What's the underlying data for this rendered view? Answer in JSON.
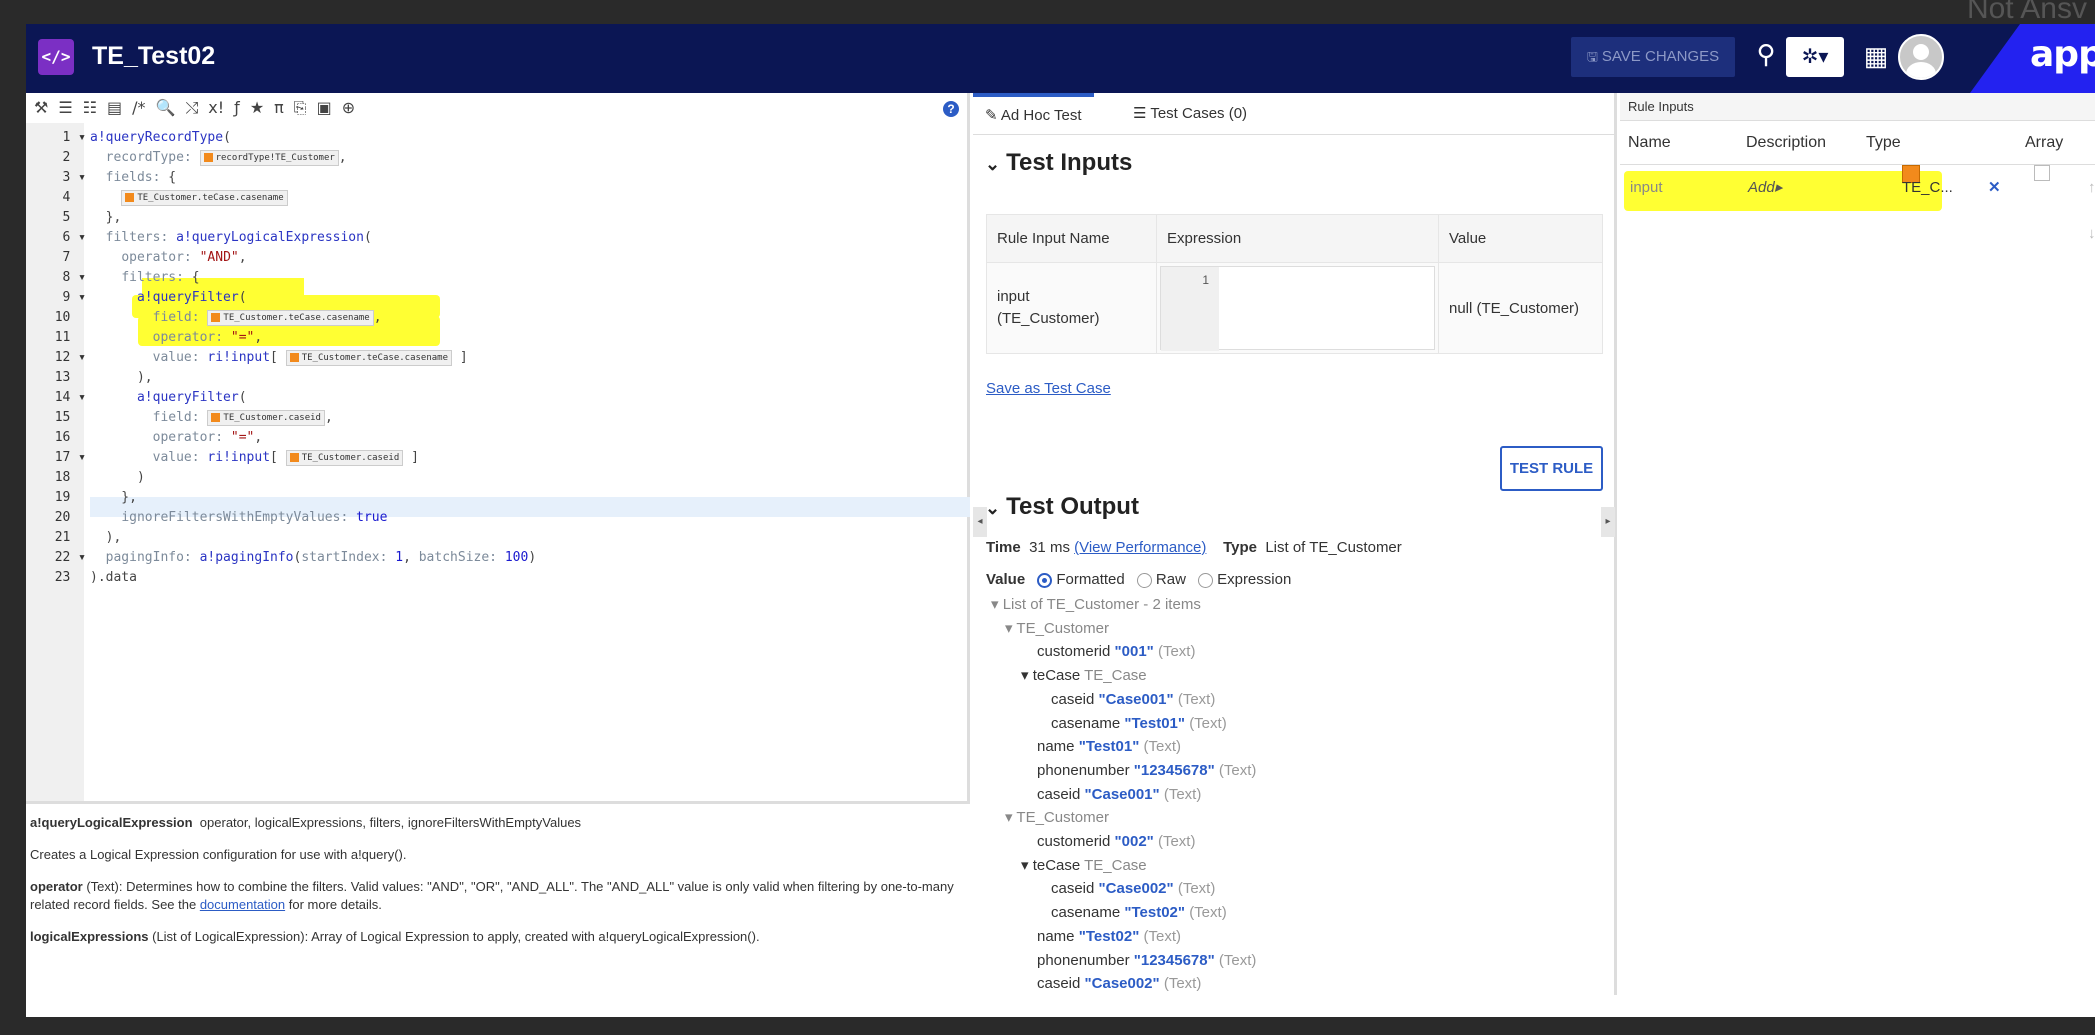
{
  "background": {
    "text": "Not Ansv"
  },
  "header": {
    "title": "TE_Test02",
    "logo_glyph": "</>",
    "save_label": "SAVE CHANGES",
    "brand": "appia",
    "icons": [
      "search-icon",
      "gear-icon",
      "apps-grid-icon",
      "user-avatar"
    ]
  },
  "editor": {
    "toolbar_icons": [
      "wrench-icon",
      "indent-icon",
      "outdent-icon",
      "list-icon",
      "comment-icon",
      "search-icon",
      "shuffle-icon",
      "xi-icon",
      "fx-icon",
      "star-icon",
      "pi-icon",
      "export-icon",
      "copy-icon",
      "web-icon"
    ],
    "toolbar_glyphs": [
      "⚒",
      "☰",
      "☷",
      "▤",
      "/*",
      "🔍",
      "⤭",
      "x!",
      "ƒ",
      "★",
      "π",
      "⎘",
      "▣",
      "⊕"
    ],
    "lines": [
      {
        "n": "1",
        "html": "<span class=\"kw\">a!queryRecordType</span>("
      },
      {
        "n": "2",
        "html": "  <span class=\"prop\">recordType:</span> <span class=\"tok\"><b></b>recordType!TE_Customer</span>,"
      },
      {
        "n": "3",
        "html": "  <span class=\"prop\">fields:</span> {"
      },
      {
        "n": "4",
        "html": "    <span class=\"tok\"><b></b>TE_Customer.teCase.casename</span>"
      },
      {
        "n": "5",
        "html": "  },"
      },
      {
        "n": "6",
        "html": "  <span class=\"prop\">filters:</span> <span class=\"kw\">a!queryLogicalExpression</span>("
      },
      {
        "n": "7",
        "html": "    <span class=\"prop\">operator:</span> <span class=\"str\">\"AND\"</span>,"
      },
      {
        "n": "8",
        "html": "    <span class=\"prop\">filters:</span> {"
      },
      {
        "n": "9",
        "html": "      <span class=\"kw\">a!queryFilter</span>("
      },
      {
        "n": "10",
        "html": "        <span class=\"prop\">field:</span> <span class=\"tok\"><b></b>TE_Customer.teCase.casename</span>,"
      },
      {
        "n": "11",
        "html": "        <span class=\"prop\">operator:</span> <span class=\"str\">\"=\"</span>,"
      },
      {
        "n": "12",
        "html": "        <span class=\"prop\">value:</span> <span class=\"kw\">ri!input</span>[ <span class=\"tok\"><b></b>TE_Customer.teCase.casename</span> ]"
      },
      {
        "n": "13",
        "html": "      ),"
      },
      {
        "n": "14",
        "html": "      <span class=\"kw\">a!queryFilter</span>("
      },
      {
        "n": "15",
        "html": "        <span class=\"prop\">field:</span> <span class=\"tok\"><b></b>TE_Customer.caseid</span>,"
      },
      {
        "n": "16",
        "html": "        <span class=\"prop\">operator:</span> <span class=\"str\">\"=\"</span>,"
      },
      {
        "n": "17",
        "html": "        <span class=\"prop\">value:</span> <span class=\"kw\">ri!input</span>[ <span class=\"tok\"><b></b>TE_Customer.caseid</span> ]"
      },
      {
        "n": "18",
        "html": "      )"
      },
      {
        "n": "19",
        "html": "    },"
      },
      {
        "n": "20",
        "html": "    <span class=\"prop\">ignoreFiltersWithEmptyValues:</span> <span class=\"num\">true</span>"
      },
      {
        "n": "21",
        "html": "  ),"
      },
      {
        "n": "22",
        "html": "  <span class=\"prop\">pagingInfo:</span> <span class=\"kw\">a!pagingInfo</span>(<span class=\"prop\">startIndex:</span> <span class=\"num\">1</span>, <span class=\"prop\">batchSize:</span> <span class=\"num\">100</span>)"
      },
      {
        "n": "23",
        "html": ").data"
      }
    ],
    "fold_lines": [
      "1",
      "3",
      "6",
      "8",
      "9",
      "12",
      "14",
      "17",
      "22"
    ],
    "doc": {
      "sig_name": "a!queryLogicalExpression",
      "sig_params": "operator, logicalExpressions, filters, ignoreFiltersWithEmptyValues",
      "desc": "Creates a Logical Expression configuration for use with a!query().",
      "op_name": "operator",
      "op_text": " (Text): Determines how to combine the filters. Valid values: \"AND\", \"OR\", \"AND_ALL\". The \"AND_ALL\" value is only valid when filtering by one-to-many related record fields. See the ",
      "op_link": "documentation",
      "op_tail": " for more details.",
      "le_name": "logicalExpressions",
      "le_text": " (List of LogicalExpression): Array of Logical Expression to apply, created with a!queryLogicalExpression()."
    }
  },
  "middle": {
    "tabs": [
      {
        "label": "Ad Hoc Test"
      },
      {
        "label": "Test Cases (0)"
      }
    ],
    "test_inputs_title": "Test Inputs",
    "columns": [
      "Rule Input Name",
      "Expression",
      "Value"
    ],
    "input_name": "input\n(TE_Customer)",
    "expr_line": "1",
    "input_value": "null (TE_Customer)",
    "save_test_case": "Save as Test Case",
    "test_rule": "TEST RULE",
    "test_output_title": "Test Output",
    "time_label": "Time",
    "time_value": "31 ms",
    "view_perf": "(View Performance)",
    "type_label": "Type",
    "type_value": "List of TE_Customer",
    "value_label": "Value",
    "radio_options": [
      "Formatted",
      "Raw",
      "Expression"
    ],
    "selected_radio": "Formatted",
    "tree_header": "List of TE_Customer - 2 items",
    "customers": [
      {
        "label": "TE_Customer",
        "customerid": "\"001\"",
        "caseid1": "\"Case001\"",
        "casename": "\"Test01\"",
        "name": "\"Test01\"",
        "phonenumber": "\"12345678\"",
        "caseid2": "\"Case001\""
      },
      {
        "label": "TE_Customer",
        "customerid": "\"002\"",
        "caseid1": "\"Case002\"",
        "casename": "\"Test02\"",
        "name": "\"Test02\"",
        "phonenumber": "\"12345678\"",
        "caseid2": "\"Case002\""
      }
    ],
    "field_names": {
      "customerid": "customerid",
      "tecase": "teCase",
      "tecase_type": "TE_Case",
      "caseid": "caseid",
      "casename": "casename",
      "name": "name",
      "phonenumber": "phonenumber"
    },
    "text_type": "(Text)"
  },
  "right": {
    "header": "Rule Inputs",
    "columns": [
      "Name",
      "Description",
      "Type",
      "Array"
    ],
    "row": {
      "name": "input",
      "description": "Add▸",
      "type": "TE_C...",
      "remove": "✕",
      "arrows": "↑ ↓"
    }
  },
  "colors": {
    "navy": "#0b1654",
    "accent": "#2c5cc5",
    "highlight": "#ffff33",
    "brand": "#2322f0"
  }
}
